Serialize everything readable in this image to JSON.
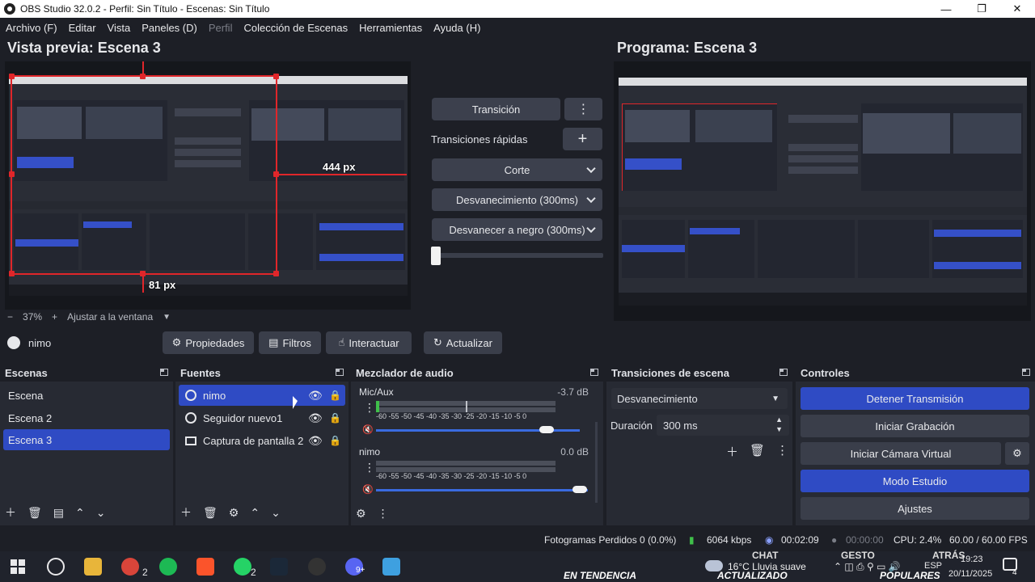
{
  "window": {
    "title": "OBS Studio 32.0.2 - Perfil: Sin Título - Escenas: Sin Título"
  },
  "menu": [
    {
      "label": "Archivo (F)",
      "disabled": false
    },
    {
      "label": "Editar",
      "disabled": false
    },
    {
      "label": "Vista",
      "disabled": false
    },
    {
      "label": "Paneles (D)",
      "disabled": false
    },
    {
      "label": "Perfil",
      "disabled": true
    },
    {
      "label": "Colección de Escenas",
      "disabled": false
    },
    {
      "label": "Herramientas",
      "disabled": false
    },
    {
      "label": "Ayuda (H)",
      "disabled": false
    }
  ],
  "preview": {
    "title": "Vista previa: Escena 3",
    "zoom_minus": "−",
    "zoom": "37%",
    "zoom_plus": "+",
    "fit": "Ajustar a la ventana",
    "dim_horizontal": "444 px",
    "dim_vertical": "81 px"
  },
  "program": {
    "title": "Programa: Escena 3"
  },
  "transitions_center": {
    "transition_button": "Transición",
    "quick_label": "Transiciones rápidas",
    "quick_add": "+",
    "items": [
      "Corte",
      "Desvanecimiento (300ms)",
      "Desvanecer a negro (300ms)"
    ],
    "tbar_value": 0
  },
  "source_toolbar": {
    "source_name": "nimo",
    "properties": "Propiedades",
    "filters": "Filtros",
    "interact": "Interactuar",
    "refresh": "Actualizar"
  },
  "scenes": {
    "title": "Escenas",
    "items": [
      "Escena",
      "Escena 2",
      "Escena 3"
    ],
    "selected_index": 2
  },
  "sources": {
    "title": "Fuentes",
    "items": [
      {
        "name": "nimo",
        "icon": "browser-icon",
        "visible": true,
        "locked": true
      },
      {
        "name": "Seguidor nuevo1",
        "icon": "browser-icon",
        "visible": true,
        "locked": true
      },
      {
        "name": "Captura de pantalla 2",
        "icon": "monitor-icon",
        "visible": true,
        "locked": true
      }
    ],
    "selected_index": 0
  },
  "mixer": {
    "title": "Mezclador de audio",
    "scale": "-60 -55 -50 -45 -40 -35 -30 -25 -20 -15 -10 -5 0",
    "channels": [
      {
        "name": "Mic/Aux",
        "db": "-3.7 dB",
        "volume": 0.9,
        "muted": true
      },
      {
        "name": "nimo",
        "db": "0.0 dB",
        "volume": 1.0,
        "muted": true
      }
    ]
  },
  "scene_transitions": {
    "title": "Transiciones de escena",
    "selected": "Desvanecimiento",
    "duration_label": "Duración",
    "duration_value": "300 ms"
  },
  "controls": {
    "title": "Controles",
    "stop_stream": "Detener Transmisión",
    "start_recording": "Iniciar Grabación",
    "start_virtual_cam": "Iniciar Cámara Virtual",
    "studio_mode": "Modo Estudio",
    "settings": "Ajustes"
  },
  "status": {
    "dropped_frames": "Fotogramas Perdidos 0 (0.0%)",
    "bitrate": "6064 kbps",
    "stream_time": "00:02:09",
    "record_time": "00:00:00",
    "cpu": "CPU: 2.4%",
    "fps": "60.00 / 60.00 FPS"
  },
  "taskbar": {
    "weather": "16°C Lluvia suave",
    "language": "ESP",
    "time": "19:23",
    "date": "20/11/2025",
    "notifications": "4",
    "news_1": "EN TENDENCIA",
    "news_2": "ACTUALIZADO",
    "news_3": "POPULARES",
    "chat": "CHAT",
    "gesto": "GESTO",
    "atras": "ATRÁS",
    "whatsapp_badge": "2",
    "chrome_badge": "2",
    "discord_badge": "9+"
  },
  "colors": {
    "accent_blue": "#2f4bc4",
    "red_guides": "#e0262a",
    "background": "#1d1f26",
    "dock": "#272a33"
  }
}
